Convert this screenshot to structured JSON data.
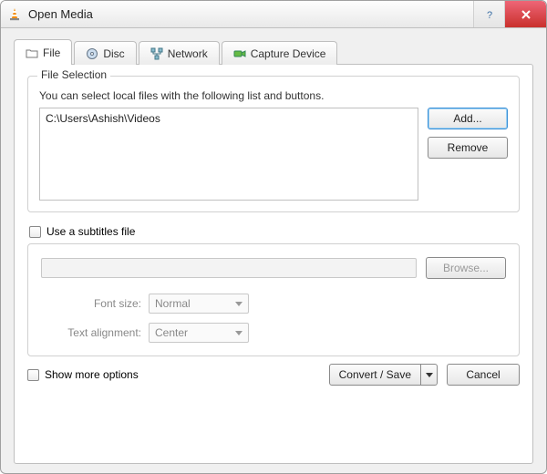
{
  "window": {
    "title": "Open Media"
  },
  "tabs": {
    "file": "File",
    "disc": "Disc",
    "network": "Network",
    "capture": "Capture Device"
  },
  "fileSelection": {
    "legend": "File Selection",
    "hint": "You can select local files with the following list and buttons.",
    "files": [
      "C:\\Users\\Ashish\\Videos"
    ],
    "add": "Add...",
    "remove": "Remove"
  },
  "subtitles": {
    "checkbox": "Use a subtitles file",
    "browse": "Browse...",
    "fontSizeLabel": "Font size:",
    "fontSizeValue": "Normal",
    "alignLabel": "Text alignment:",
    "alignValue": "Center"
  },
  "moreOptions": "Show more options",
  "footer": {
    "convert": "Convert / Save",
    "cancel": "Cancel"
  }
}
